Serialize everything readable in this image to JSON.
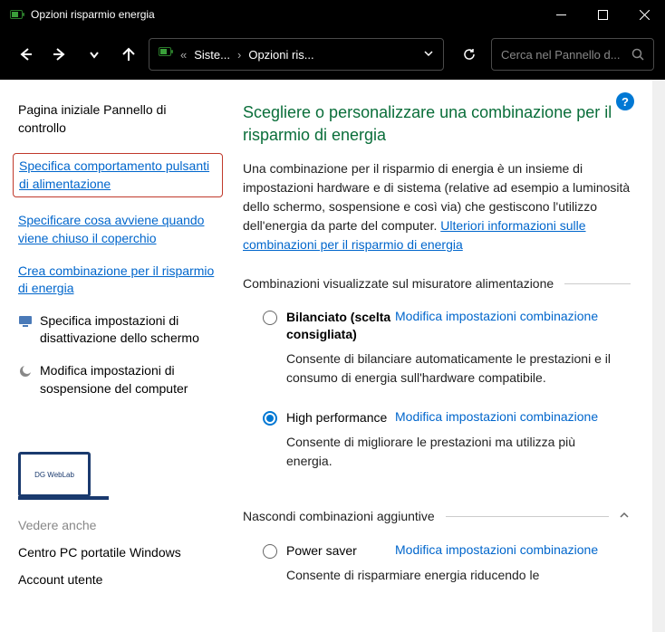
{
  "window": {
    "title": "Opzioni risparmio energia"
  },
  "breadcrumb": {
    "item1": "Siste...",
    "item2": "Opzioni ris..."
  },
  "search": {
    "placeholder": "Cerca nel Pannello d..."
  },
  "sidebar": {
    "home": "Pagina iniziale Pannello di controllo",
    "links": [
      "Specifica comportamento pulsanti di alimentazione",
      "Specificare cosa avviene quando viene chiuso il coperchio",
      "Crea combinazione per il risparmio di energia"
    ],
    "iconitems": [
      "Specifica impostazioni di disattivazione dello schermo",
      "Modifica impostazioni di sospensione del computer"
    ],
    "logo_text": "DG WebLab",
    "seealso": "Vedere anche",
    "related": [
      "Centro PC portatile Windows",
      "Account utente"
    ]
  },
  "main": {
    "heading": "Scegliere o personalizzare una combinazione per il risparmio di energia",
    "description": "Una combinazione per il risparmio di energia è un insieme di impostazioni hardware e di sistema (relative ad esempio a luminosità dello schermo, sospensione e così via) che gestiscono l'utilizzo dell'energia da parte del computer.",
    "moreinfo": "Ulteriori informazioni sulle combinazioni per il risparmio di energia",
    "section1": "Combinazioni visualizzate sul misuratore alimentazione",
    "section2": "Nascondi combinazioni aggiuntive",
    "modify_link": "Modifica impostazioni combinazione",
    "plans": [
      {
        "name": "Bilanciato (scelta consigliata)",
        "desc": "Consente di bilanciare automaticamente le prestazioni e il consumo di energia sull'hardware compatibile.",
        "selected": false,
        "bold": true
      },
      {
        "name": "High performance",
        "desc": "Consente di migliorare le prestazioni ma utilizza più energia.",
        "selected": true,
        "bold": false
      }
    ],
    "hidden_plan": {
      "name": "Power saver",
      "desc_partial": "Consente di risparmiare energia riducendo le"
    }
  }
}
